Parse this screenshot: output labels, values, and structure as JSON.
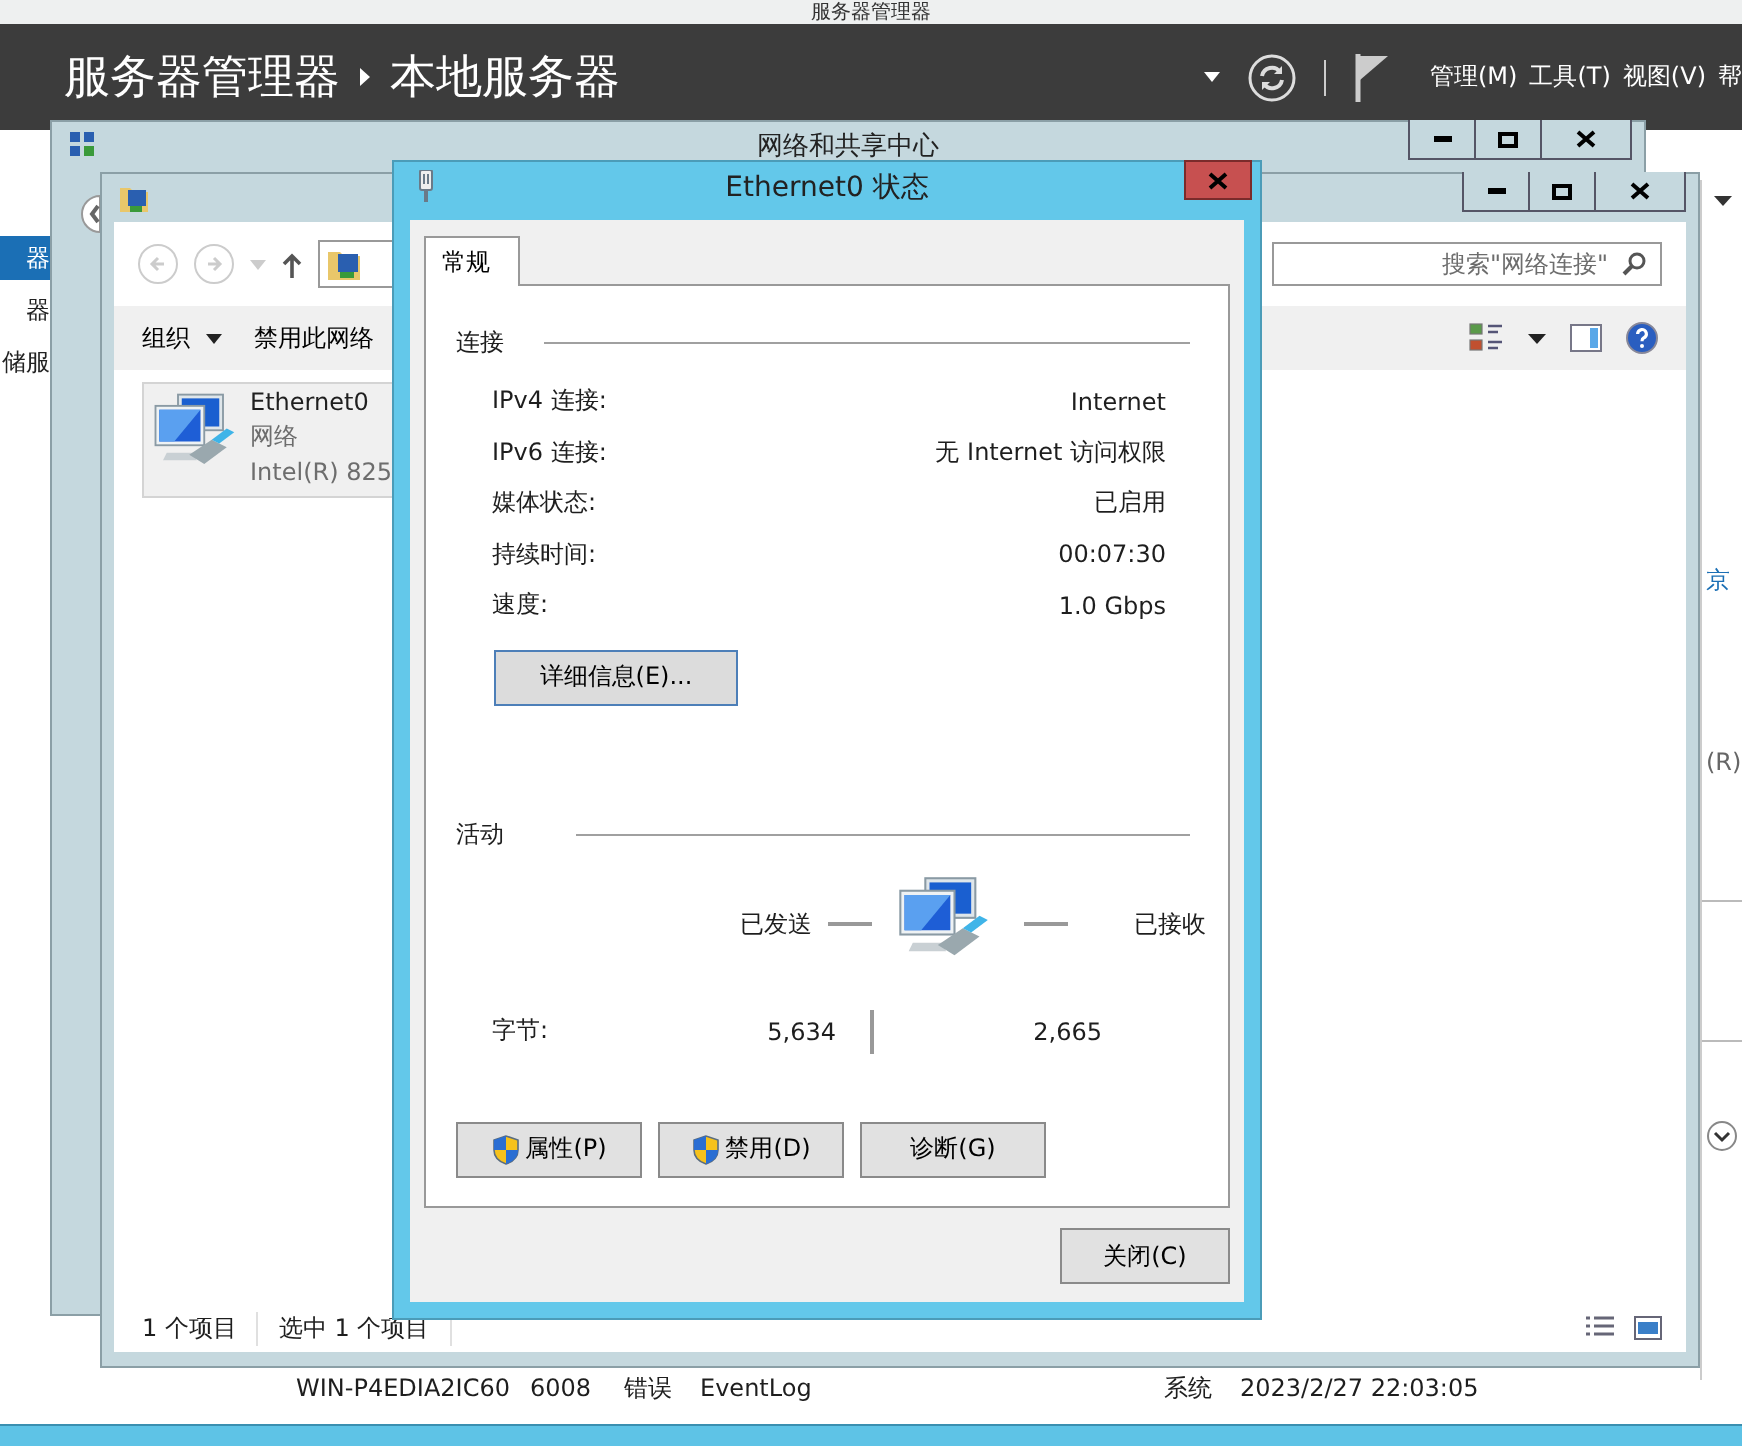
{
  "server_manager": {
    "title": "服务器管理器",
    "breadcrumb": [
      "服务器管理器",
      "本地服务器"
    ],
    "menus": [
      "管理(M)",
      "工具(T)",
      "视图(V)",
      "帮"
    ],
    "sidebar": [
      {
        "label": "器",
        "selected": true
      },
      {
        "label": "器",
        "selected": false
      },
      {
        "label": "储服",
        "selected": false
      }
    ],
    "fragments": [
      "京",
      "(R)"
    ],
    "event_row": [
      "WIN-P4EDIA2IC60",
      "6008",
      "错误",
      "EventLog",
      "系统",
      "2023/2/27 22:03:05"
    ]
  },
  "sharing_center": {
    "title": "网络和共享中心"
  },
  "connections_window": {
    "search": {
      "placeholder": "搜索\"网络连接\""
    },
    "toolbar": [
      {
        "label": "组织",
        "kind": "menu"
      },
      {
        "label": "禁用此网络",
        "kind": "button"
      }
    ],
    "items": [
      {
        "name": "Ethernet0",
        "type": "网络",
        "device": "Intel(R) 825",
        "selected": true
      }
    ],
    "status": [
      "1 个项目",
      "选中 1 个项目"
    ]
  },
  "dialog": {
    "title": "Ethernet0 状态",
    "tabs": [
      {
        "label": "常规",
        "selected": true
      }
    ],
    "connection": {
      "heading": "连接",
      "rows": [
        {
          "label": "IPv4 连接:",
          "value": "Internet"
        },
        {
          "label": "IPv6 连接:",
          "value": "无 Internet 访问权限"
        },
        {
          "label": "媒体状态:",
          "value": "已启用"
        },
        {
          "label": "持续时间:",
          "value": "00:07:30"
        },
        {
          "label": "速度:",
          "value": "1.0 Gbps"
        }
      ],
      "details_button": "详细信息(E)..."
    },
    "activity": {
      "heading": "活动",
      "sent_label": "已发送",
      "received_label": "已接收",
      "bytes_label": "字节:",
      "sent": "5,634",
      "received": "2,665"
    },
    "buttons": [
      {
        "label": "属性(P)",
        "shield": true
      },
      {
        "label": "禁用(D)",
        "shield": true
      },
      {
        "label": "诊断(G)",
        "shield": false
      }
    ],
    "close_button": "关闭(C)"
  }
}
